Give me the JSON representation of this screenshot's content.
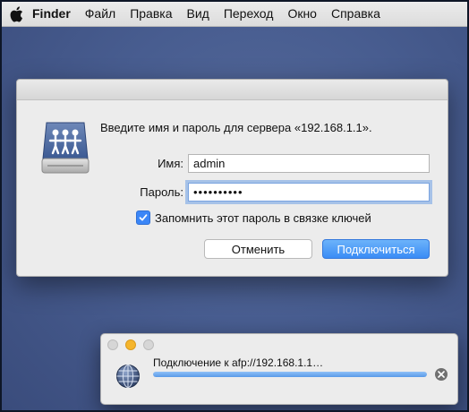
{
  "menubar": {
    "apple_icon": "apple-logo-icon",
    "app_name": "Finder",
    "items": [
      "Файл",
      "Правка",
      "Вид",
      "Переход",
      "Окно",
      "Справка"
    ]
  },
  "auth_dialog": {
    "icon": "shared-server-icon",
    "prompt": "Введите имя и пароль для сервера «192.168.1.1».",
    "name_label": "Имя:",
    "name_value": "admin",
    "password_label": "Пароль:",
    "password_value": "••••••••••",
    "remember_label": "Запомнить этот пароль в связке ключей",
    "remember_checked": true,
    "cancel_label": "Отменить",
    "connect_label": "Подключиться",
    "accent_color": "#3b86f7"
  },
  "progress_window": {
    "icon": "network-globe-icon",
    "status_text": "Подключение к afp://192.168.1.1…",
    "progress_fraction": 1.0,
    "stop_icon": "stop-icon"
  }
}
